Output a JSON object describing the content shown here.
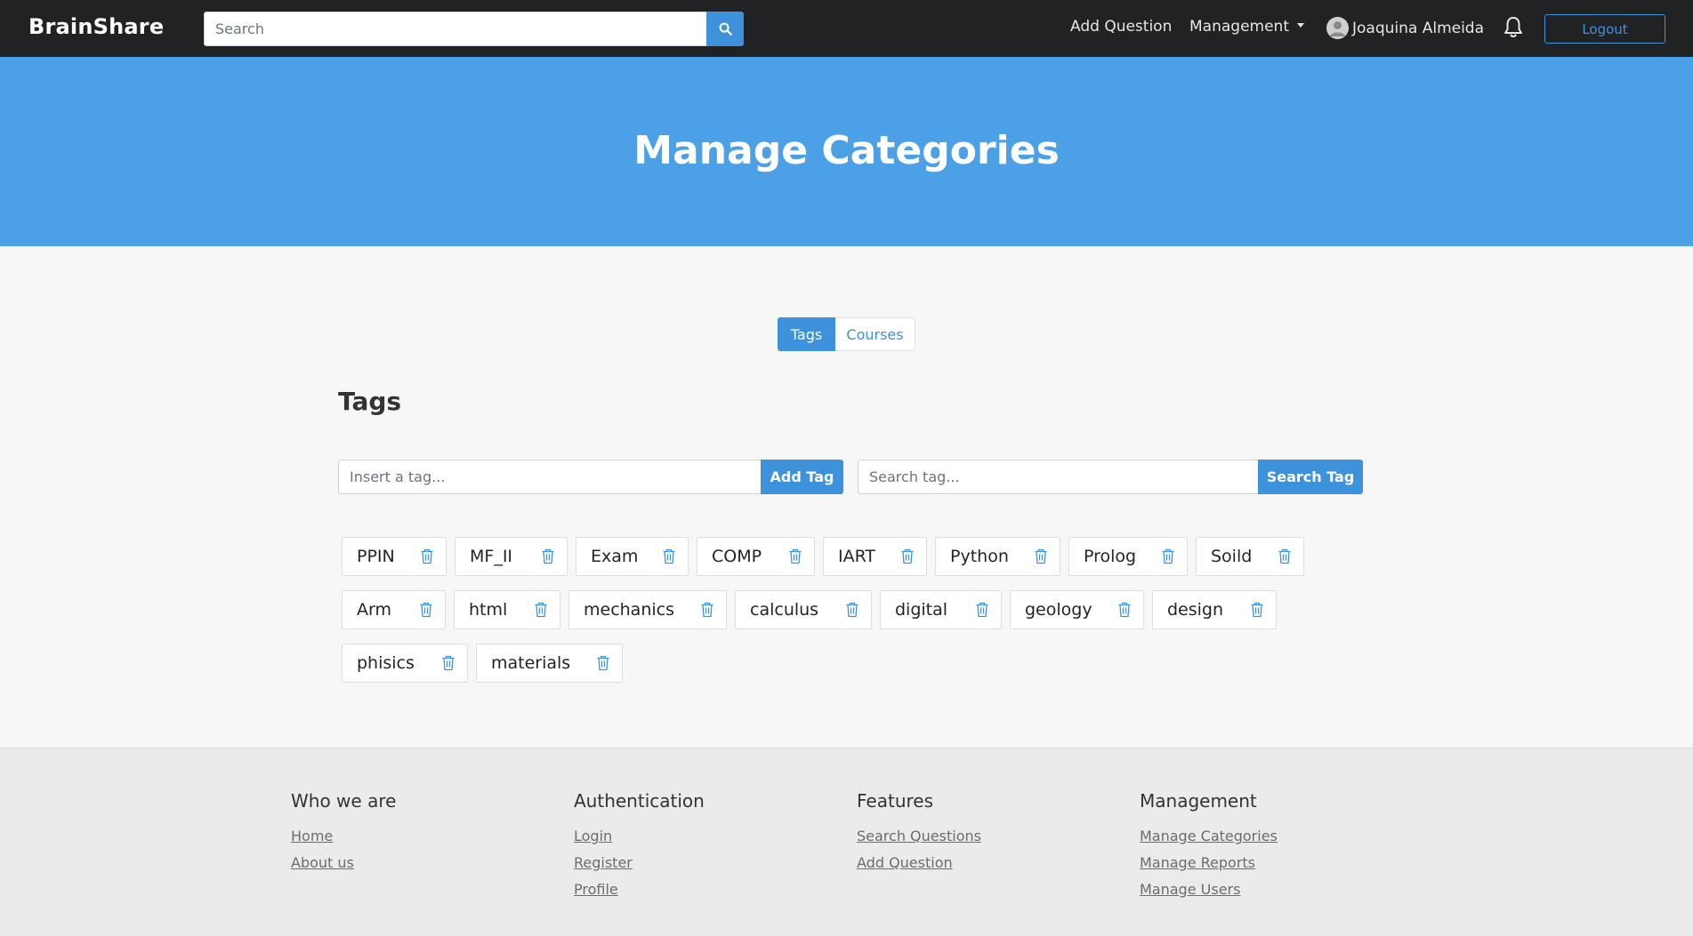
{
  "navbar": {
    "brand": "BrainShare",
    "search_placeholder": "Search",
    "add_question": "Add Question",
    "management": "Management",
    "user_name": "Joaquina Almeida",
    "logout": "Logout"
  },
  "hero": {
    "title": "Manage Categories"
  },
  "toggle": {
    "tags": "Tags",
    "courses": "Courses"
  },
  "tags_section": {
    "title": "Tags",
    "insert_placeholder": "Insert a tag...",
    "add_button": "Add Tag",
    "search_placeholder": "Search tag...",
    "search_button": "Search Tag",
    "rows": [
      [
        "PPIN",
        "MF_II",
        "Exam",
        "COMP",
        "IART",
        "Python",
        "Prolog",
        "Soild"
      ],
      [
        "Arm",
        "html",
        "mechanics",
        "calculus",
        "digital",
        "geology",
        "design"
      ],
      [
        "phisics",
        "materials"
      ]
    ]
  },
  "footer": {
    "who": {
      "title": "Who we are",
      "links": [
        "Home",
        "About us"
      ]
    },
    "auth": {
      "title": "Authentication",
      "links": [
        "Login",
        "Register",
        "Profile"
      ]
    },
    "features": {
      "title": "Features",
      "links": [
        "Search Questions",
        "Add Question"
      ]
    },
    "management": {
      "title": "Management",
      "links": [
        "Manage Categories",
        "Manage Reports",
        "Manage Users"
      ]
    }
  },
  "icons": {
    "search": "search-icon",
    "bell": "bell-icon",
    "trash": "trash-icon",
    "avatar": "user-avatar-icon"
  },
  "colors": {
    "navbar": "#212224",
    "hero": "#4ba0e6",
    "accent": "#3e92dc"
  }
}
